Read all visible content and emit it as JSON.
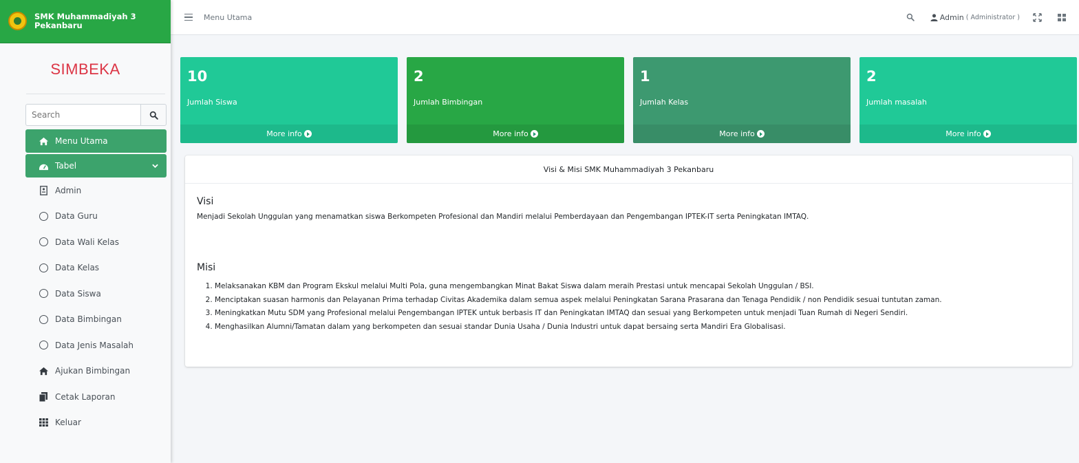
{
  "sidebar": {
    "brand": "SMK Muhammadiyah 3 Pekanbaru",
    "app_title": "SIMBEKA",
    "search_placeholder": "Search",
    "items": [
      {
        "label": "Menu Utama",
        "icon": "home-icon"
      },
      {
        "label": "Tabel",
        "icon": "dashboard-icon"
      },
      {
        "label": "Admin",
        "icon": "id-card-icon"
      },
      {
        "label": "Data Guru",
        "icon": "circle-icon"
      },
      {
        "label": "Data Wali Kelas",
        "icon": "circle-icon"
      },
      {
        "label": "Data Kelas",
        "icon": "circle-icon"
      },
      {
        "label": "Data Siswa",
        "icon": "circle-icon"
      },
      {
        "label": "Data Bimbingan",
        "icon": "circle-icon"
      },
      {
        "label": "Data Jenis Masalah",
        "icon": "circle-icon"
      },
      {
        "label": "Ajukan Bimbingan",
        "icon": "home-icon"
      },
      {
        "label": "Cetak Laporan",
        "icon": "copy-icon"
      },
      {
        "label": "Keluar",
        "icon": "grid-icon"
      }
    ]
  },
  "topbar": {
    "title": "Menu Utama",
    "user_name": "Admin",
    "user_role": "( Administrator )"
  },
  "stats": [
    {
      "value": "10",
      "label": "Jumlah Siswa",
      "more": "More info",
      "color": "#20c997"
    },
    {
      "value": "2",
      "label": "Jumlah Bimbingan",
      "more": "More info",
      "color": "#28a745"
    },
    {
      "value": "1",
      "label": "Jumlah Kelas",
      "more": "More info",
      "color": "#3d9970"
    },
    {
      "value": "2",
      "label": "Jumlah masalah",
      "more": "More info",
      "color": "#20c997"
    }
  ],
  "card": {
    "header": "Visi & Misi SMK Muhammadiyah 3 Pekanbaru",
    "visi_title": "Visi",
    "visi_text": "Menjadi Sekolah Unggulan yang menamatkan siswa Berkompeten Profesional dan Mandiri melalui Pemberdayaan dan Pengembangan IPTEK-IT serta Peningkatan IMTAQ.",
    "misi_title": "Misi",
    "misi": [
      "Melaksanakan KBM dan Program Ekskul melalui Multi Pola, guna mengembangkan Minat Bakat Siswa dalam meraih Prestasi untuk mencapai Sekolah Unggulan / BSI.",
      "Menciptakan suasan harmonis dan Pelayanan Prima terhadap Civitas Akademika dalam semua aspek melalui Peningkatan Sarana Prasarana dan Tenaga Pendidik / non Pendidik sesuai tuntutan zaman.",
      "Meningkatkan Mutu SDM yang Profesional melalui Pengembangan IPTEK untuk berbasis IT dan Peningkatan IMTAQ dan sesuai yang Berkompeten untuk menjadi Tuan Rumah di Negeri Sendiri.",
      "Menghasilkan Alumni/Tamatan dalam yang berkompeten dan sesuai standar Dunia Usaha / Dunia Industri untuk dapat bersaing serta Mandiri Era Globalisasi."
    ]
  }
}
